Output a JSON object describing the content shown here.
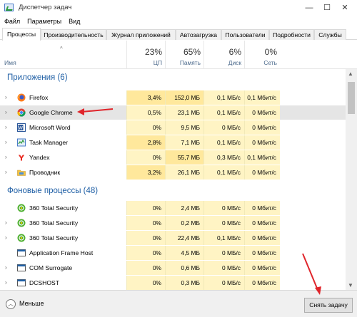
{
  "window": {
    "title": "Диспетчер задач",
    "minimize_glyph": "—",
    "maximize_glyph": "☐",
    "close_glyph": "✕"
  },
  "menu": [
    "Файл",
    "Параметры",
    "Вид"
  ],
  "tabs": [
    {
      "label": "Процессы",
      "active": true
    },
    {
      "label": "Производительность"
    },
    {
      "label": "Журнал приложений"
    },
    {
      "label": "Автозагрузка"
    },
    {
      "label": "Пользователи"
    },
    {
      "label": "Подробности"
    },
    {
      "label": "Службы"
    }
  ],
  "header": {
    "sort_glyph": "^",
    "name": "Имя",
    "cpu": {
      "pct": "23%",
      "label": "ЦП"
    },
    "memory": {
      "pct": "65%",
      "label": "Память"
    },
    "disk": {
      "pct": "6%",
      "label": "Диск"
    },
    "network": {
      "pct": "0%",
      "label": "Сеть"
    }
  },
  "groups": {
    "apps": {
      "title": "Приложения (6)",
      "rows": [
        {
          "name": "Firefox",
          "icon": "firefox-icon",
          "cpu": "3,4%",
          "memory": "152,0 МБ",
          "disk": "0,1 МБ/с",
          "network": "0,1 Мбит/с"
        },
        {
          "name": "Google Chrome",
          "icon": "chrome-icon",
          "cpu": "0,5%",
          "memory": "23,1 МБ",
          "disk": "0,1 МБ/с",
          "network": "0 Мбит/с"
        },
        {
          "name": "Microsoft Word",
          "icon": "word-icon",
          "cpu": "0%",
          "memory": "9,5 МБ",
          "disk": "0 МБ/с",
          "network": "0 Мбит/с"
        },
        {
          "name": "Task Manager",
          "icon": "task-manager-icon",
          "cpu": "2,8%",
          "memory": "7,1 МБ",
          "disk": "0,1 МБ/с",
          "network": "0 Мбит/с"
        },
        {
          "name": "Yandex",
          "icon": "yandex-icon",
          "cpu": "0%",
          "memory": "55,7 МБ",
          "disk": "0,3 МБ/с",
          "network": "0,1 Мбит/с"
        },
        {
          "name": "Проводник",
          "icon": "explorer-icon",
          "cpu": "3,2%",
          "memory": "26,1 МБ",
          "disk": "0,1 МБ/с",
          "network": "0 Мбит/с"
        }
      ]
    },
    "background": {
      "title": "Фоновые процессы (48)",
      "rows": [
        {
          "name": "360 Total Security",
          "icon": "360-security-icon",
          "cpu": "0%",
          "memory": "2,4 МБ",
          "disk": "0 МБ/с",
          "network": "0 Мбит/с"
        },
        {
          "name": "360 Total Security",
          "icon": "360-security-icon",
          "cpu": "0%",
          "memory": "0,2 МБ",
          "disk": "0 МБ/с",
          "network": "0 Мбит/с"
        },
        {
          "name": "360 Total Security",
          "icon": "360-security-icon",
          "cpu": "0%",
          "memory": "22,4 МБ",
          "disk": "0,1 МБ/с",
          "network": "0 Мбит/с"
        },
        {
          "name": "Application Frame Host",
          "icon": "app-frame-icon",
          "cpu": "0%",
          "memory": "4,5 МБ",
          "disk": "0 МБ/с",
          "network": "0 Мбит/с"
        },
        {
          "name": "COM Surrogate",
          "icon": "com-surrogate-icon",
          "cpu": "0%",
          "memory": "0,6 МБ",
          "disk": "0 МБ/с",
          "network": "0 Мбит/с"
        },
        {
          "name": "DCSHOST",
          "icon": "dcshost-icon",
          "cpu": "0%",
          "memory": "0,3 МБ",
          "disk": "0 МБ/с",
          "network": "0 Мбит/с"
        }
      ]
    }
  },
  "footer": {
    "less_label": "Меньше",
    "end_task_label": "Снять задачу"
  },
  "colors": {
    "annotation_arrow": "#e0252b",
    "group_title": "#1f5fa5",
    "cell_highlight": "#fff4c4"
  }
}
